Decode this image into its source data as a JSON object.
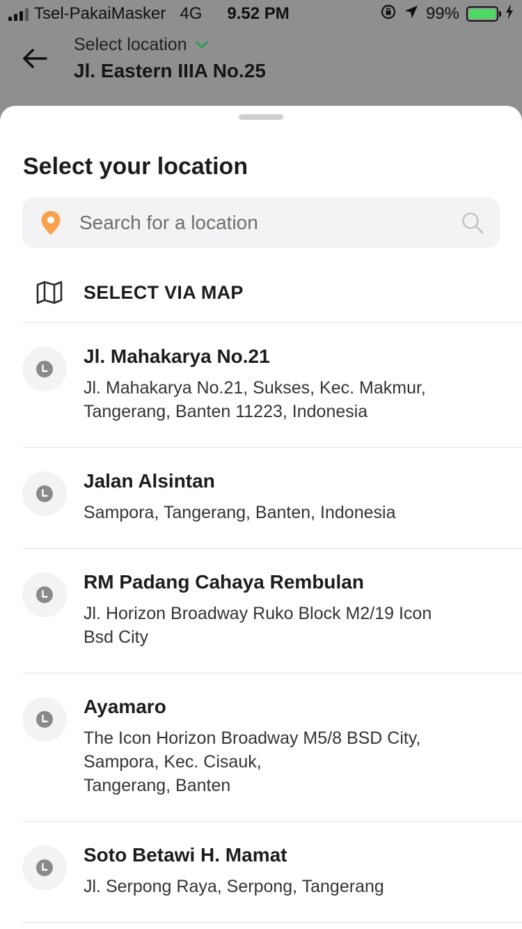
{
  "status_bar": {
    "carrier": "Tsel-PakaiMasker",
    "network": "4G",
    "time": "9.52 PM",
    "battery": "99%",
    "battery_level": 0.99,
    "battery_color": "#4cd964"
  },
  "header": {
    "label": "Select location",
    "address": "Jl. Eastern IIIA No.25",
    "accent_color": "#2e9e4f"
  },
  "sheet": {
    "title": "Select your location",
    "search": {
      "placeholder": "Search for a location",
      "value": "",
      "pin_color": "#f7a14b"
    },
    "map_option": {
      "label": "SELECT VIA MAP",
      "icon": "map-icon"
    },
    "locations": [
      {
        "name": "Jl. Mahakarya No.21",
        "address": "Jl. Mahakarya No.21, Sukses, Kec. Makmur,\nTangerang, Banten 11223, Indonesia",
        "icon": "clock-icon"
      },
      {
        "name": "Jalan Alsintan",
        "address": "Sampora, Tangerang, Banten, Indonesia",
        "icon": "clock-icon"
      },
      {
        "name": "RM Padang Cahaya Rembulan",
        "address": "Jl. Horizon Broadway Ruko Block M2/19 Icon\nBsd City",
        "icon": "clock-icon"
      },
      {
        "name": "Ayamaro",
        "address": "The Icon Horizon Broadway M5/8 BSD City,\nSampora, Kec. Cisauk,\nTangerang, Banten",
        "icon": "clock-icon"
      },
      {
        "name": "Soto Betawi H. Mamat",
        "address": "Jl. Serpong Raya, Serpong, Tangerang",
        "icon": "clock-icon"
      }
    ]
  }
}
